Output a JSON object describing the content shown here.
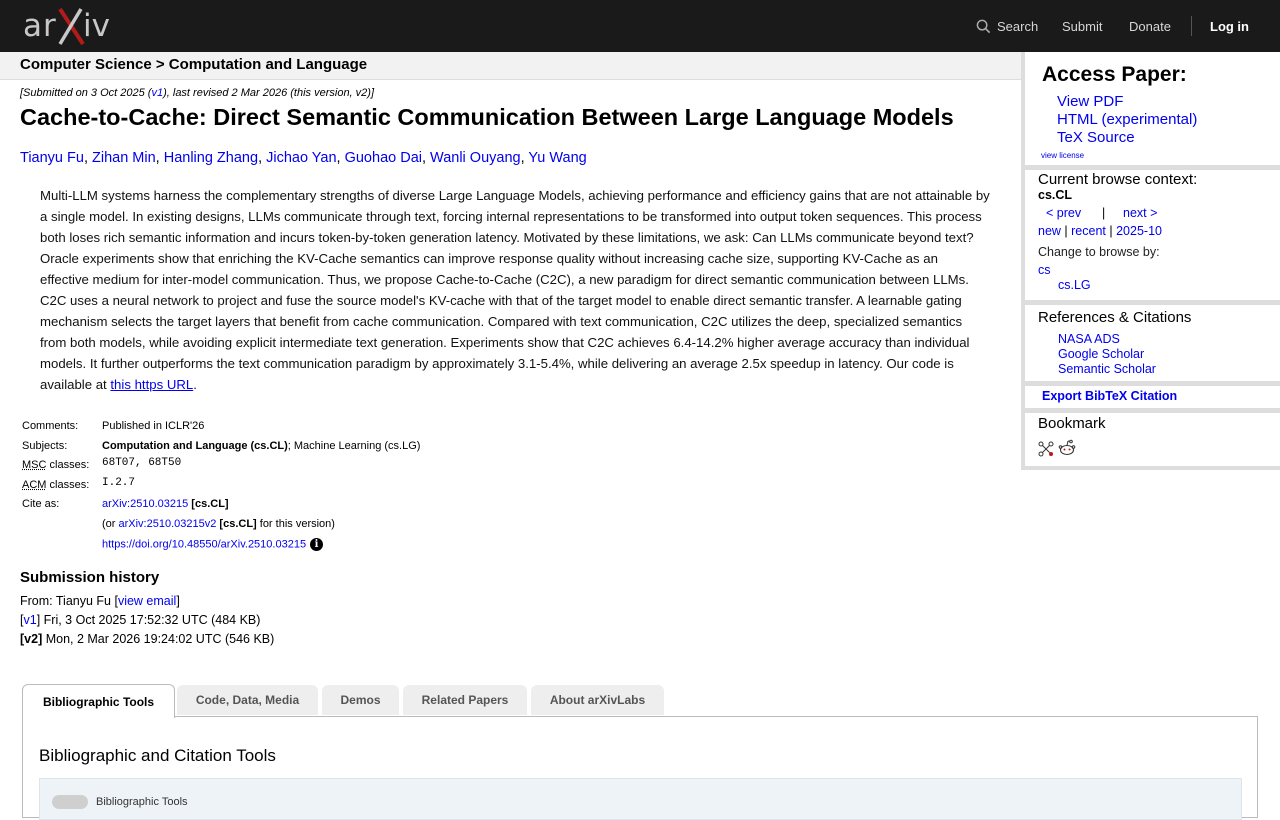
{
  "header": {
    "logo_text": "arXiv",
    "search": "Search",
    "submit": "Submit",
    "donate": "Donate",
    "login": "Log in"
  },
  "breadcrumb": "Computer Science > Computation and Language",
  "paper": {
    "submitted": "[Submitted on 3 Oct 2025 (",
    "submitted_v1": "v1",
    "submitted_rest": "), last revised 2 Mar 2026 (this version, v2)]",
    "title": "Cache-to-Cache: Direct Semantic Communication Between Large Language Models",
    "authors": [
      "Tianyu Fu",
      "Zihan Min",
      "Hanling Zhang",
      "Jichao Yan",
      "Guohao Dai",
      "Wanli Ouyang",
      "Yu Wang"
    ],
    "abstract": "Multi-LLM systems harness the complementary strengths of diverse Large Language Models, achieving performance and efficiency gains that are not attainable by a single model. In existing designs, LLMs communicate through text, forcing internal representations to be transformed into output token sequences. This process both loses rich semantic information and incurs token-by-token generation latency. Motivated by these limitations, we ask: Can LLMs communicate beyond text? Oracle experiments show that enriching the KV-Cache semantics can improve response quality without increasing cache size, supporting KV-Cache as an effective medium for inter-model communication. Thus, we propose Cache-to-Cache (C2C), a new paradigm for direct semantic communication between LLMs. C2C uses a neural network to project and fuse the source model's KV-cache with that of the target model to enable direct semantic transfer. A learnable gating mechanism selects the target layers that benefit from cache communication. Compared with text communication, C2C utilizes the deep, specialized semantics from both models, while avoiding explicit intermediate text generation. Experiments show that C2C achieves 6.4-14.2% higher average accuracy than individual models. It further outperforms the text communication paradigm by approximately 3.1-5.4%, while delivering an average 2.5x speedup in latency. Our code is available at ",
    "abstract_link": "this https URL",
    "abstract_end": "."
  },
  "meta": {
    "comments_label": "Comments:",
    "comments": "Published in ICLR'26",
    "subjects_label": "Subjects:",
    "subjects_primary": "Computation and Language (cs.CL)",
    "subjects_rest": "; Machine Learning (cs.LG)",
    "msc_abbr": "MSC",
    "msc_label": " classes:",
    "msc": "68T07, 68T50",
    "acm_abbr": "ACM",
    "acm_label": " classes:",
    "acm": "I.2.7",
    "cite_label": "Cite as:",
    "cite_id": "arXiv:2510.03215",
    "cite_cat": " [cs.CL]",
    "cite2_pre": "(or ",
    "cite2_id": "arXiv:2510.03215v2",
    "cite2_cat": " [cs.CL]",
    "cite2_post": " for this version)",
    "doi": "https://doi.org/10.48550/arXiv.2510.03215",
    "info_glyph": "i"
  },
  "history": {
    "title": "Submission history",
    "from_pre": "From: Tianyu Fu [",
    "from_link": "view email",
    "from_post": "]",
    "v1_link": "v1",
    "v1_text": " Fri, 3 Oct 2025 17:52:32 UTC (484 KB)",
    "v2_label": "[v2]",
    "v2_text": " Mon, 2 Mar 2026 19:24:02 UTC (546 KB)"
  },
  "tabs": [
    "Bibliographic Tools",
    "Code, Data, Media",
    "Demos",
    "Related Papers",
    "About arXivLabs"
  ],
  "panel": {
    "title": "Bibliographic and Citation Tools",
    "toggle_label": "Bibliographic Tools"
  },
  "sidebar": {
    "access_title": "Access Paper:",
    "view_pdf": "View PDF",
    "html": "HTML (experimental)",
    "tex": "TeX Source",
    "license": "view license",
    "context_title": "Current browse context:",
    "context_cat": "cs.CL",
    "prev": "< prev",
    "sep": "|",
    "next": "next >",
    "new": "new",
    "recent": "recent",
    "month": "2025-10",
    "change_label": "Change to browse by:",
    "cat_cs": "cs",
    "cat_lg": "cs.LG",
    "refs_title": "References & Citations",
    "nasa": "NASA ADS",
    "scholar": "Google Scholar",
    "semantic": "Semantic Scholar",
    "bibtex": "Export BibTeX Citation",
    "bookmark": "Bookmark"
  }
}
